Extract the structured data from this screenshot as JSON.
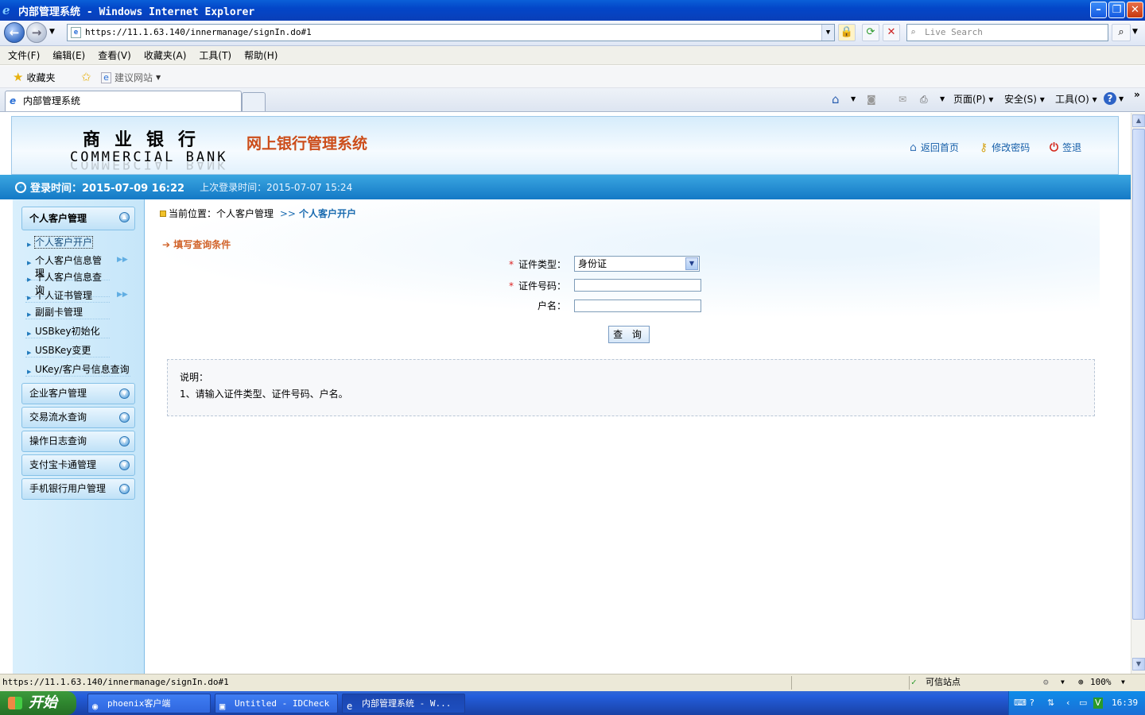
{
  "window": {
    "title": "内部管理系统 - Windows Internet Explorer"
  },
  "browser": {
    "url": "https://11.1.63.140/innermanage/signIn.do#1",
    "search_placeholder": "Live Search",
    "menu": [
      "文件(F)",
      "编辑(E)",
      "查看(V)",
      "收藏夹(A)",
      "工具(T)",
      "帮助(H)"
    ],
    "favorites_label": "收藏夹",
    "suggested_sites": "建议网站",
    "tab_title": "内部管理系统",
    "commands": {
      "page": "页面(P)",
      "safety": "安全(S)",
      "tools": "工具(O)"
    }
  },
  "header": {
    "logo_cn": "商业银行",
    "logo_en": "COMMERCIAL BANK",
    "system_name": "网上银行管理系统",
    "links": {
      "home": "返回首页",
      "change_password": "修改密码",
      "logout": "签退"
    }
  },
  "login_info": {
    "current": "登录时间：2015-07-09 16:22",
    "previous": "上次登录时间：2015-07-07 15:24"
  },
  "sidebar": {
    "open_group": "个人客户管理",
    "items": [
      {
        "label": "个人客户开户"
      },
      {
        "label": "个人客户信息管理"
      },
      {
        "label": "个人客户信息查询"
      },
      {
        "label": "个人证书管理"
      },
      {
        "label": "副副卡管理"
      },
      {
        "label": "USBkey初始化"
      },
      {
        "label": "USBKey变更"
      },
      {
        "label": "UKey/客户号信息查询"
      }
    ],
    "groups": [
      "企业客户管理",
      "交易流水查询",
      "操作日志查询",
      "支付宝卡通管理",
      "手机银行用户管理"
    ]
  },
  "breadcrumb": {
    "prefix": "当前位置：个人客户管理",
    "sep": ">>",
    "current": "个人客户开户"
  },
  "form": {
    "section_title": "填写查询条件",
    "id_type_label": "证件类型：",
    "id_type_value": "身份证",
    "id_number_label": "证件号码：",
    "id_number_value": "",
    "name_label": "户名：",
    "name_value": "",
    "required_mark": "*",
    "submit_label": "查 询"
  },
  "note": {
    "title": "说明：",
    "line1": "1、请输入证件类型、证件号码、户名。"
  },
  "statusbar": {
    "url": "https://11.1.63.140/innermanage/signIn.do#1",
    "zone": "可信站点",
    "zoom": "100%"
  },
  "taskbar": {
    "start": "开始",
    "tasks": [
      "phoenix客户端",
      "Untitled - IDCheck",
      "内部管理系统 - W..."
    ],
    "clock": "16:39"
  }
}
